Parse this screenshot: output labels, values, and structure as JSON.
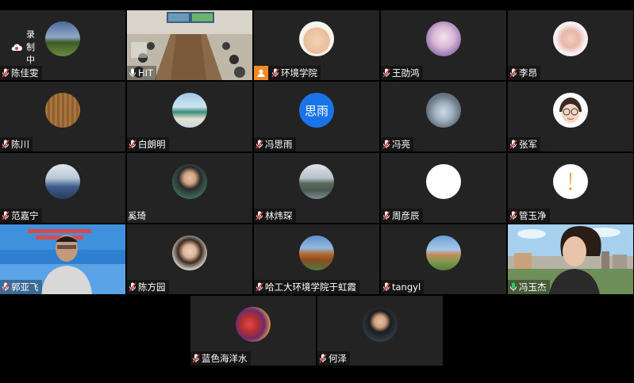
{
  "recording": {
    "label": "录制中"
  },
  "participants": [
    {
      "name": "陈佳雯",
      "mic": "muted",
      "avatar": "landscape-photo"
    },
    {
      "name": "HIT",
      "mic": "on",
      "video": "meeting-room"
    },
    {
      "name": "环境学院",
      "mic": "muted",
      "host": true,
      "avatar": "baby-photo"
    },
    {
      "name": "王劭鸿",
      "mic": "muted",
      "avatar": "anime-photo"
    },
    {
      "name": "李昂",
      "mic": "muted",
      "avatar": "child-photo"
    },
    {
      "name": "陈川",
      "mic": "muted",
      "avatar": "wood-texture"
    },
    {
      "name": "白朗明",
      "mic": "muted",
      "avatar": "beach-photo"
    },
    {
      "name": "冯思雨",
      "mic": "muted",
      "avatar_text": "思雨"
    },
    {
      "name": "冯亮",
      "mic": "muted",
      "avatar": "bottle-photo"
    },
    {
      "name": "张军",
      "mic": "muted",
      "avatar": "cartoon-face"
    },
    {
      "name": "范嘉宁",
      "mic": "muted",
      "avatar": "people-photo"
    },
    {
      "name": "奚琦",
      "mic": "none",
      "avatar": "woman-photo"
    },
    {
      "name": "林炜琛",
      "mic": "muted",
      "avatar": "river-photo"
    },
    {
      "name": "周彦辰",
      "mic": "muted",
      "avatar": "white-circle"
    },
    {
      "name": "管玉净",
      "mic": "muted",
      "avatar": "exclamation-icon"
    },
    {
      "name": "郭亚飞",
      "mic": "muted",
      "video": "banner-man"
    },
    {
      "name": "陈方园",
      "mic": "muted",
      "avatar": "girl-photo"
    },
    {
      "name": "哈工大环境学院于虹霞",
      "mic": "muted",
      "avatar": "city-photo"
    },
    {
      "name": "tangyl",
      "mic": "muted",
      "avatar": "campus-photo"
    },
    {
      "name": "冯玉杰",
      "mic": "on",
      "video": "woman-cityscape"
    },
    {
      "name": "蓝色海洋水",
      "mic": "muted",
      "avatar": "group-photo"
    },
    {
      "name": "何泽",
      "mic": "muted",
      "avatar": "young-man-photo"
    }
  ]
}
